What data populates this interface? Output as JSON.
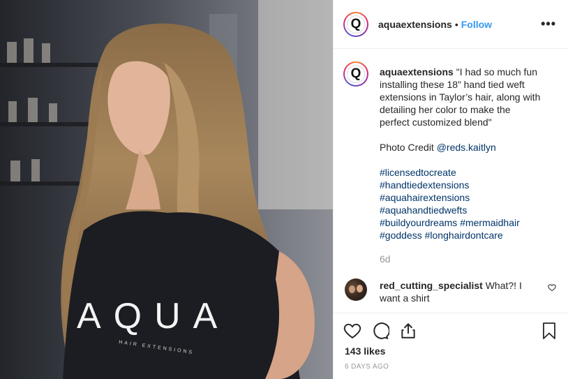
{
  "header": {
    "username": "aquaextensions",
    "separator": "•",
    "follow_label": "Follow",
    "more_label": "•••"
  },
  "avatar": {
    "letter": "Q"
  },
  "caption": {
    "username": "aquaextensions",
    "lines": [
      "\"I had so much fun",
      "installing these 18” hand tied weft",
      "extensions in Taylor’s hair, along with",
      "detailing her color to make the",
      "perfect customized blend\""
    ],
    "credit_prefix": "Photo Credit ",
    "credit_mention": "@reds.kaitlyn",
    "hashtag_lines": [
      [
        "#licensedtocreate"
      ],
      [
        "#handtiedextensions"
      ],
      [
        "#aquahairextensions"
      ],
      [
        "#aquahandtiedwefts"
      ],
      [
        "#buildyourdreams",
        "#mermaidhair"
      ],
      [
        "#goddess",
        "#longhairdontcare"
      ]
    ],
    "timestamp": "6d"
  },
  "comment": {
    "username": "red_cutting_specialist",
    "text_line1": " What?! I",
    "text_line2": "want a shirt"
  },
  "photo": {
    "shirt_text": "AQUA",
    "shirt_subtext": "HAIR EXTENSIONS"
  },
  "footer": {
    "likes": "143 likes",
    "time_ago": "6 DAYS AGO"
  },
  "icons": [
    "heart-icon",
    "comment-icon",
    "share-icon",
    "bookmark-icon",
    "more-icon",
    "comment-like-heart-icon"
  ],
  "colors": {
    "follow": "#3897f0",
    "hashtag": "#003569",
    "muted": "#999999",
    "text": "#262626"
  }
}
